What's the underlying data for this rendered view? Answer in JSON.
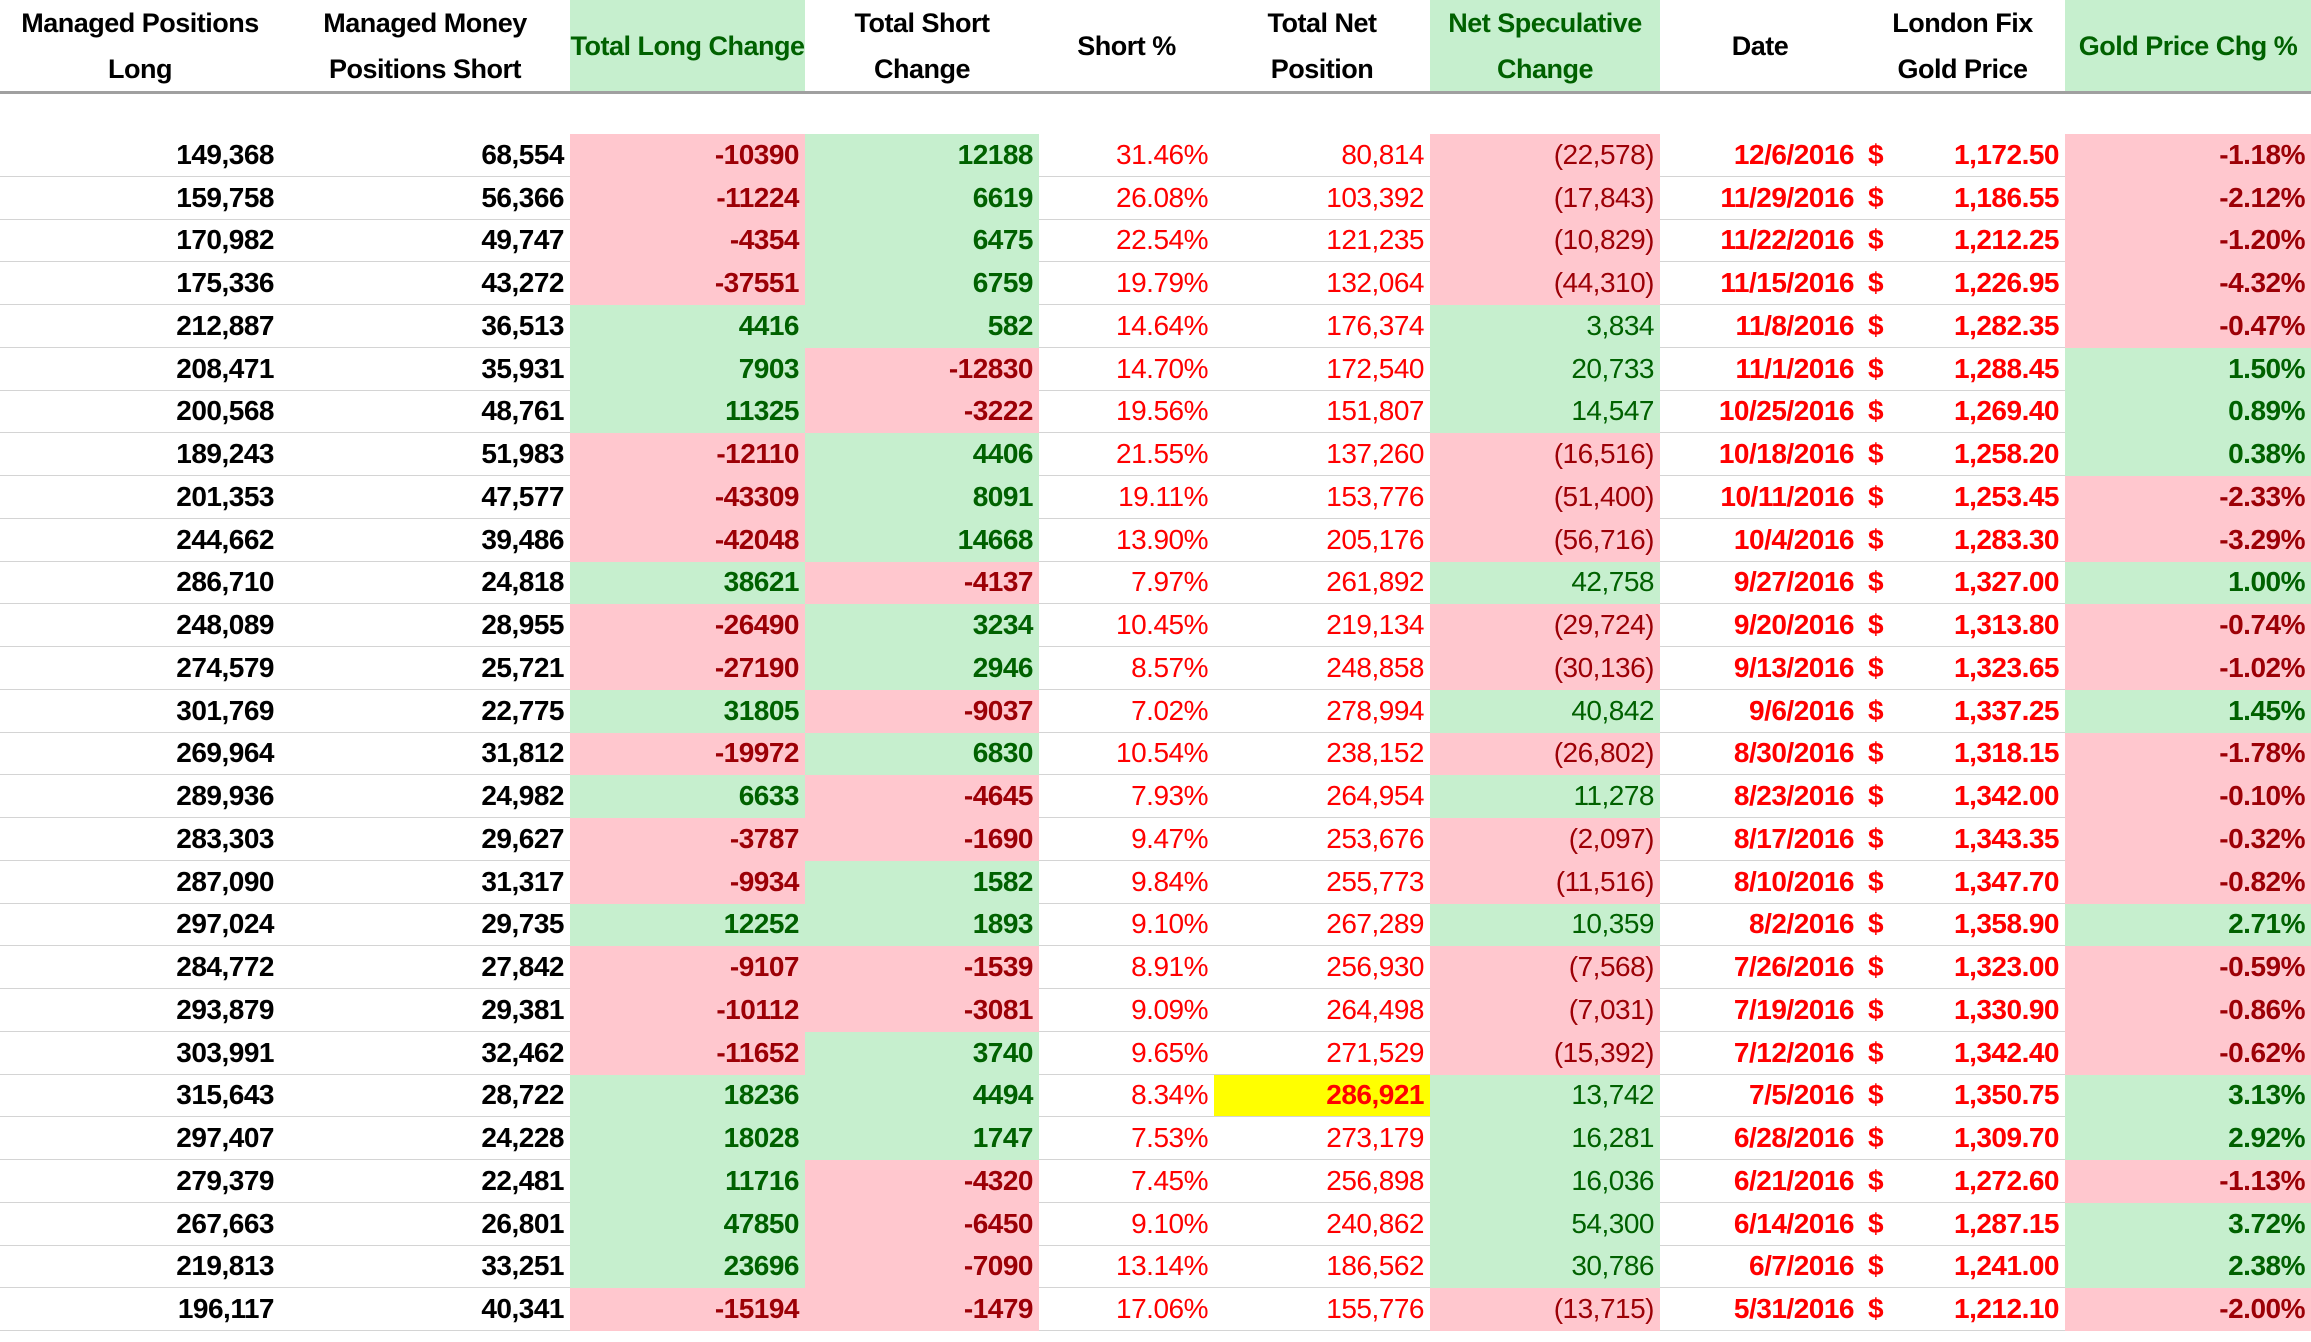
{
  "headers": [
    {
      "label": "Managed Positions Long",
      "highlight": false
    },
    {
      "label": "Managed Money Positions Short",
      "highlight": false
    },
    {
      "label": "Total Long Change",
      "highlight": true
    },
    {
      "label": "Total Short Change",
      "highlight": false
    },
    {
      "label": "Short %",
      "highlight": false
    },
    {
      "label": "Total Net Position",
      "highlight": false
    },
    {
      "label": "Net Speculative Change",
      "highlight": true
    },
    {
      "label": "Date",
      "highlight": false
    },
    {
      "label": "London Fix Gold Price",
      "highlight": false
    },
    {
      "label": "Gold Price Chg %",
      "highlight": true
    }
  ],
  "currency_symbol": "$",
  "colors": {
    "negative_fill": "#FFC7CE",
    "negative_text": "#9C0006",
    "positive_fill": "#C6EFCE",
    "positive_text": "#006100",
    "highlight": "#FFFF00",
    "red_text": "#FF0000"
  },
  "highlighted_cell": {
    "row": 22,
    "column": "Total Net Position"
  },
  "rows": [
    [
      "149,368",
      "68,554",
      "-10390",
      "12188",
      "31.46%",
      "80,814",
      "(22,578)",
      "12/6/2016",
      "1,172.50",
      "-1.18%"
    ],
    [
      "159,758",
      "56,366",
      "-11224",
      "6619",
      "26.08%",
      "103,392",
      "(17,843)",
      "11/29/2016",
      "1,186.55",
      "-2.12%"
    ],
    [
      "170,982",
      "49,747",
      "-4354",
      "6475",
      "22.54%",
      "121,235",
      "(10,829)",
      "11/22/2016",
      "1,212.25",
      "-1.20%"
    ],
    [
      "175,336",
      "43,272",
      "-37551",
      "6759",
      "19.79%",
      "132,064",
      "(44,310)",
      "11/15/2016",
      "1,226.95",
      "-4.32%"
    ],
    [
      "212,887",
      "36,513",
      "4416",
      "582",
      "14.64%",
      "176,374",
      "3,834",
      "11/8/2016",
      "1,282.35",
      "-0.47%"
    ],
    [
      "208,471",
      "35,931",
      "7903",
      "-12830",
      "14.70%",
      "172,540",
      "20,733",
      "11/1/2016",
      "1,288.45",
      "1.50%"
    ],
    [
      "200,568",
      "48,761",
      "11325",
      "-3222",
      "19.56%",
      "151,807",
      "14,547",
      "10/25/2016",
      "1,269.40",
      "0.89%"
    ],
    [
      "189,243",
      "51,983",
      "-12110",
      "4406",
      "21.55%",
      "137,260",
      "(16,516)",
      "10/18/2016",
      "1,258.20",
      "0.38%"
    ],
    [
      "201,353",
      "47,577",
      "-43309",
      "8091",
      "19.11%",
      "153,776",
      "(51,400)",
      "10/11/2016",
      "1,253.45",
      "-2.33%"
    ],
    [
      "244,662",
      "39,486",
      "-42048",
      "14668",
      "13.90%",
      "205,176",
      "(56,716)",
      "10/4/2016",
      "1,283.30",
      "-3.29%"
    ],
    [
      "286,710",
      "24,818",
      "38621",
      "-4137",
      "7.97%",
      "261,892",
      "42,758",
      "9/27/2016",
      "1,327.00",
      "1.00%"
    ],
    [
      "248,089",
      "28,955",
      "-26490",
      "3234",
      "10.45%",
      "219,134",
      "(29,724)",
      "9/20/2016",
      "1,313.80",
      "-0.74%"
    ],
    [
      "274,579",
      "25,721",
      "-27190",
      "2946",
      "8.57%",
      "248,858",
      "(30,136)",
      "9/13/2016",
      "1,323.65",
      "-1.02%"
    ],
    [
      "301,769",
      "22,775",
      "31805",
      "-9037",
      "7.02%",
      "278,994",
      "40,842",
      "9/6/2016",
      "1,337.25",
      "1.45%"
    ],
    [
      "269,964",
      "31,812",
      "-19972",
      "6830",
      "10.54%",
      "238,152",
      "(26,802)",
      "8/30/2016",
      "1,318.15",
      "-1.78%"
    ],
    [
      "289,936",
      "24,982",
      "6633",
      "-4645",
      "7.93%",
      "264,954",
      "11,278",
      "8/23/2016",
      "1,342.00",
      "-0.10%"
    ],
    [
      "283,303",
      "29,627",
      "-3787",
      "-1690",
      "9.47%",
      "253,676",
      "(2,097)",
      "8/17/2016",
      "1,343.35",
      "-0.32%"
    ],
    [
      "287,090",
      "31,317",
      "-9934",
      "1582",
      "9.84%",
      "255,773",
      "(11,516)",
      "8/10/2016",
      "1,347.70",
      "-0.82%"
    ],
    [
      "297,024",
      "29,735",
      "12252",
      "1893",
      "9.10%",
      "267,289",
      "10,359",
      "8/2/2016",
      "1,358.90",
      "2.71%"
    ],
    [
      "284,772",
      "27,842",
      "-9107",
      "-1539",
      "8.91%",
      "256,930",
      "(7,568)",
      "7/26/2016",
      "1,323.00",
      "-0.59%"
    ],
    [
      "293,879",
      "29,381",
      "-10112",
      "-3081",
      "9.09%",
      "264,498",
      "(7,031)",
      "7/19/2016",
      "1,330.90",
      "-0.86%"
    ],
    [
      "303,991",
      "32,462",
      "-11652",
      "3740",
      "9.65%",
      "271,529",
      "(15,392)",
      "7/12/2016",
      "1,342.40",
      "-0.62%"
    ],
    [
      "315,643",
      "28,722",
      "18236",
      "4494",
      "8.34%",
      "286,921",
      "13,742",
      "7/5/2016",
      "1,350.75",
      "3.13%"
    ],
    [
      "297,407",
      "24,228",
      "18028",
      "1747",
      "7.53%",
      "273,179",
      "16,281",
      "6/28/2016",
      "1,309.70",
      "2.92%"
    ],
    [
      "279,379",
      "22,481",
      "11716",
      "-4320",
      "7.45%",
      "256,898",
      "16,036",
      "6/21/2016",
      "1,272.60",
      "-1.13%"
    ],
    [
      "267,663",
      "26,801",
      "47850",
      "-6450",
      "9.10%",
      "240,862",
      "54,300",
      "6/14/2016",
      "1,287.15",
      "3.72%"
    ],
    [
      "219,813",
      "33,251",
      "23696",
      "-7090",
      "13.14%",
      "186,562",
      "30,786",
      "6/7/2016",
      "1,241.00",
      "2.38%"
    ],
    [
      "196,117",
      "40,341",
      "-15194",
      "-1479",
      "17.06%",
      "155,776",
      "(13,715)",
      "5/31/2016",
      "1,212.10",
      "-2.00%"
    ]
  ]
}
